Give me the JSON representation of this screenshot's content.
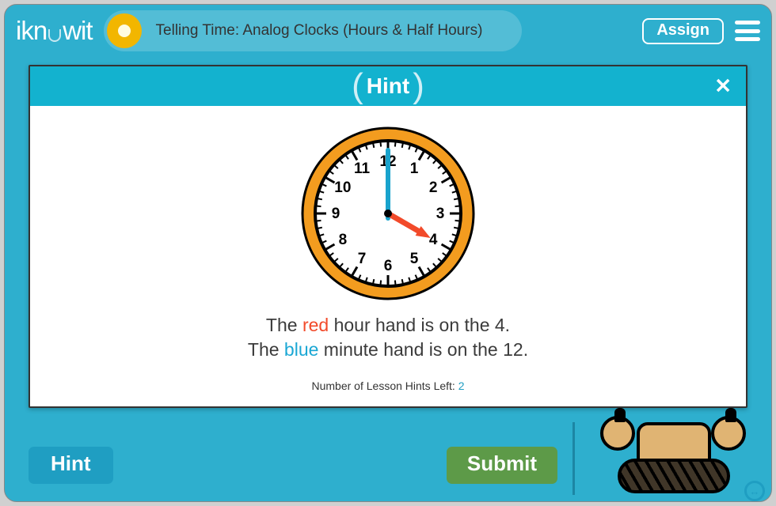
{
  "header": {
    "logo_l": "ikn",
    "logo_r": "wit",
    "lesson_title": "Telling Time: Analog Clocks (Hours & Half Hours)",
    "assign_label": "Assign"
  },
  "bottom": {
    "hint_label": "Hint",
    "submit_label": "Submit"
  },
  "modal": {
    "title": "Hint",
    "close_glyph": "✕",
    "line1_pre": "The ",
    "line1_color": "red",
    "line1_post": " hour hand is on the 4.",
    "line2_pre": "The ",
    "line2_color": "blue",
    "line2_post": " minute hand is on the 12.",
    "hints_left_label": "Number of Lesson Hints Left: ",
    "hints_left_count": "2"
  },
  "clock": {
    "numbers": [
      "12",
      "1",
      "2",
      "3",
      "4",
      "5",
      "6",
      "7",
      "8",
      "9",
      "10",
      "11"
    ],
    "hour_hand_on": 4,
    "minute_hand_on": 12
  }
}
